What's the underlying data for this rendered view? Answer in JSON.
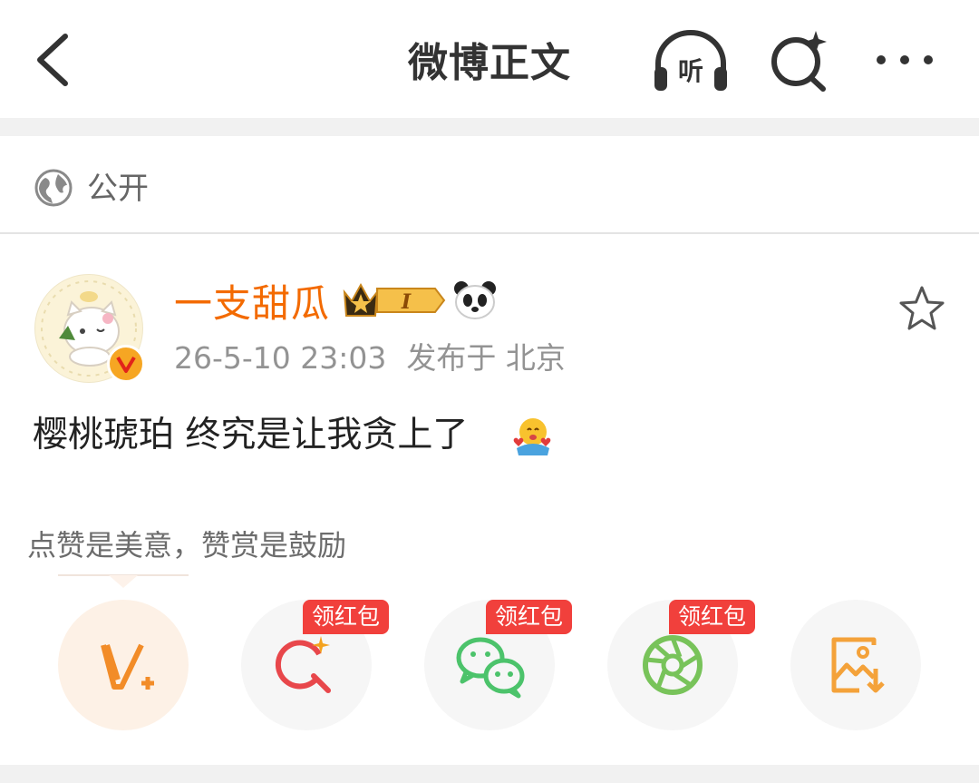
{
  "header": {
    "title": "微博正文",
    "back_icon": "back-arrow-icon",
    "listen_icon": "headphones-icon",
    "listen_label": "听",
    "search_icon": "ai-search-icon",
    "more_icon": "more-dots-icon"
  },
  "visibility": {
    "icon": "globe-icon",
    "label": "公开"
  },
  "post": {
    "username": "一支甜瓜",
    "level_badge": "I",
    "timestamp": "26-5-10 23:03",
    "location": "发布于 北京",
    "content": "樱桃琥珀 终究是让我贪上了",
    "accent_color": "#f36a00",
    "verified_color": "#f6a623"
  },
  "reward": {
    "hint": "点赞是美意，赞赏是鼓励",
    "actions": [
      {
        "icon": "v-plus-icon"
      },
      {
        "icon": "weibo-search-share-icon",
        "tag": "领红包"
      },
      {
        "icon": "wechat-icon",
        "tag": "领红包"
      },
      {
        "icon": "moments-icon",
        "tag": "领红包"
      },
      {
        "icon": "save-image-icon"
      }
    ],
    "tag_color": "#f1403c"
  }
}
